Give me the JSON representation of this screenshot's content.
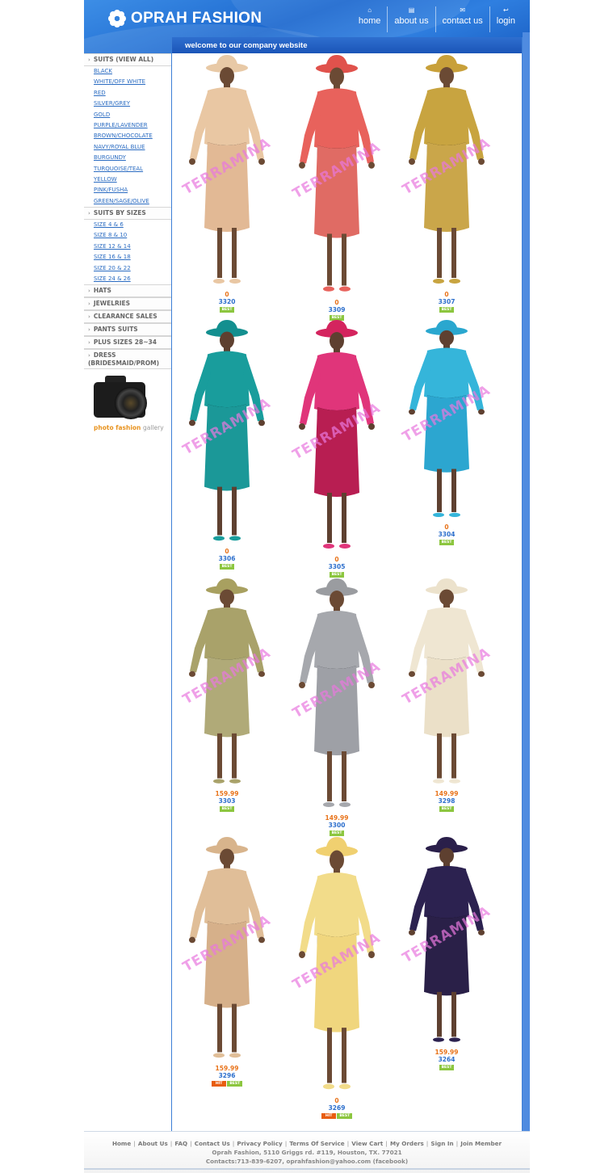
{
  "header": {
    "logo_text": "OPRAH FASHION",
    "nav": [
      {
        "label": "home",
        "icon": "home-icon"
      },
      {
        "label": "about us",
        "icon": "info-icon"
      },
      {
        "label": "contact us",
        "icon": "mail-icon"
      },
      {
        "label": "login",
        "icon": "login-icon"
      }
    ]
  },
  "welcome": "welcome to our company website",
  "sidebar": {
    "sections": [
      {
        "title": "SUITS (VIEW ALL)",
        "items": [
          "BLACK",
          "WHITE/OFF WHITE",
          "RED",
          "SILVER/GREY",
          "GOLD",
          "PURPLE/LAVENDER",
          "BROWN/CHOCOLATE",
          "NAVY/ROYAL BLUE",
          "BURGUNDY",
          "TURQUOISE/TEAL",
          "YELLOW",
          "PINK/FUSHA",
          "GREEN/SAGE/OLIVE"
        ]
      },
      {
        "title": "SUITS BY SIZES",
        "items": [
          "SIZE 4 & 6",
          "SIZE 8 & 10",
          "SIZE 12 & 14",
          "SIZE 16 & 18",
          "SIZE 20 & 22",
          "SIZE 24 & 26"
        ]
      },
      {
        "title": "HATS",
        "items": []
      },
      {
        "title": "JEWELRIES",
        "items": []
      },
      {
        "title": "CLEARANCE SALES",
        "items": []
      },
      {
        "title": "PANTS SUITS",
        "items": []
      },
      {
        "title": "PLUS SIZES 28~34",
        "items": []
      },
      {
        "title": "DRESS (BRIDESMAID/PROM)",
        "items": []
      }
    ],
    "gallery": {
      "accent": "photo fashion",
      "rest": "gallery"
    }
  },
  "watermark": "TERRAMINA",
  "products": [
    {
      "price": "0",
      "code": "3320",
      "badges": [
        "BEST"
      ],
      "colors": {
        "hat": "#e8c9a6",
        "jacket": "#e9c7a3",
        "skirt": "#e2b995",
        "skin": "#6b4a34"
      }
    },
    {
      "price": "0",
      "code": "3309",
      "badges": [
        "BEST"
      ],
      "colors": {
        "hat": "#e0524c",
        "jacket": "#e8625c",
        "skirt": "#e06b64",
        "skin": "#6b4a34"
      }
    },
    {
      "price": "0",
      "code": "3307",
      "badges": [
        "BEST"
      ],
      "colors": {
        "hat": "#c8a03a",
        "jacket": "#c8a440",
        "skirt": "#caa64a",
        "skin": "#6b4a34"
      }
    },
    {
      "price": "0",
      "code": "3306",
      "badges": [
        "BEST"
      ],
      "colors": {
        "hat": "#138f8f",
        "jacket": "#199d9c",
        "skirt": "#1b9898",
        "skin": "#5e4030"
      }
    },
    {
      "price": "0",
      "code": "3305",
      "badges": [
        "BEST"
      ],
      "colors": {
        "hat": "#d4245e",
        "jacket": "#e0357a",
        "skirt": "#b81e52",
        "skin": "#5e4030"
      }
    },
    {
      "price": "0",
      "code": "3304",
      "badges": [
        "BEST"
      ],
      "colors": {
        "hat": "#2aa7cf",
        "jacket": "#35b5da",
        "skirt": "#2ca6d0",
        "skin": "#5e4030"
      }
    },
    {
      "price": "159.99",
      "code": "3303",
      "badges": [
        "BEST"
      ],
      "colors": {
        "hat": "#a8a060",
        "jacket": "#a9a26a",
        "skirt": "#b0aa78",
        "skin": "#6b4a34"
      }
    },
    {
      "price": "149.99",
      "code": "3300",
      "badges": [
        "BEST"
      ],
      "colors": {
        "hat": "#9a9ca0",
        "jacket": "#a6a8ad",
        "skirt": "#9ea0a6",
        "skin": "#6b4a34"
      }
    },
    {
      "price": "149.99",
      "code": "3298",
      "badges": [
        "BEST"
      ],
      "colors": {
        "hat": "#ece2cc",
        "jacket": "#efe6d2",
        "skirt": "#ebe0c8",
        "skin": "#6b4a34"
      }
    },
    {
      "price": "159.99",
      "code": "3296",
      "badges": [
        "HIT",
        "BEST"
      ],
      "colors": {
        "hat": "#d8b48c",
        "jacket": "#e0be98",
        "skirt": "#d6b08a",
        "skin": "#6b4a34"
      }
    },
    {
      "price": "0",
      "code": "3269",
      "badges": [
        "HIT",
        "BEST"
      ],
      "colors": {
        "hat": "#f0d070",
        "jacket": "#f2dc8a",
        "skirt": "#f0d67e",
        "skin": "#6b4a34"
      }
    },
    {
      "price": "159.99",
      "code": "3264",
      "badges": [
        "BEST"
      ],
      "colors": {
        "hat": "#2a1f4a",
        "jacket": "#2c2250",
        "skirt": "#2a2048",
        "skin": "#5e4030"
      }
    }
  ],
  "footer": {
    "links": [
      "Home",
      "About Us",
      "FAQ",
      "Contact Us",
      "Privacy Policy",
      "Terms Of Service",
      "View Cart",
      "My Orders",
      "Sign In",
      "Join Member"
    ],
    "address": "Oprah Fashion, 5110 Griggs rd. #119, Houston, TX. 77021",
    "contacts": "Contacts:713-839-6207, oprahfashion@yahoo.com (facebook)"
  }
}
